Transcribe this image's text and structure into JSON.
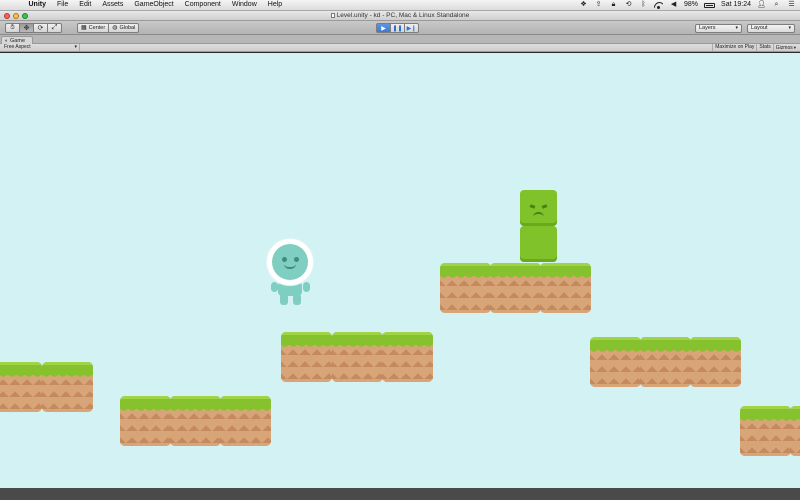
{
  "menubar": {
    "app": "Unity",
    "items": [
      "File",
      "Edit",
      "Assets",
      "GameObject",
      "Component",
      "Window",
      "Help"
    ],
    "battery": "98%",
    "clock": "Sat 19:24"
  },
  "window": {
    "title": "Level.unity - kd - PC, Mac & Linux Standalone"
  },
  "toolbar": {
    "pivot": "Center",
    "space": "Global",
    "layers": "Layers",
    "layout": "Layout"
  },
  "game_view": {
    "tab": "Game",
    "aspect": "Free Aspect",
    "maximize": "Maximize on Play",
    "stats": "Stats",
    "gizmos": "Gizmos"
  },
  "colors": {
    "sky": "#d3f2f4",
    "grass": "#86c22e",
    "dirt": "#d9a67a",
    "player": "#7ecfc1",
    "enemy": "#80c22a"
  }
}
